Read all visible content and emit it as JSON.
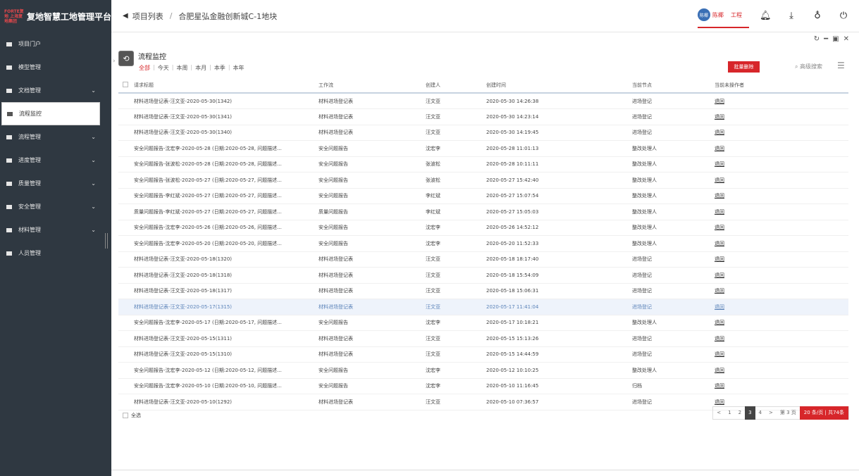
{
  "sidebar": {
    "logo_mark": "FORTE复地 上海复地集团",
    "title": "复地智慧工地管理平台",
    "items": [
      {
        "label": "项目门户",
        "chevron": false
      },
      {
        "label": "模型管理",
        "chevron": false
      },
      {
        "label": "文档管理",
        "chevron": true
      },
      {
        "label": "流程监控",
        "chevron": false,
        "active": true
      },
      {
        "label": "流程管理",
        "chevron": true
      },
      {
        "label": "进度管理",
        "chevron": true
      },
      {
        "label": "质量管理",
        "chevron": true
      },
      {
        "label": "安全管理",
        "chevron": true
      },
      {
        "label": "材料管理",
        "chevron": true
      },
      {
        "label": "人员管理",
        "chevron": false
      }
    ]
  },
  "topbar": {
    "breadcrumb": [
      "项目列表",
      "合肥星弘金融创新城C-1地块"
    ],
    "user_avatar_text": "陈椰",
    "user_name": "陈椰",
    "user_project": "工程",
    "icons": [
      "bell-icon",
      "download-icon",
      "lightbulb-icon",
      "power-icon"
    ]
  },
  "panel": {
    "title": "流程监控",
    "filters": [
      "全部",
      "今天",
      "本周",
      "本月",
      "本季",
      "本年"
    ],
    "active_filter": "全部",
    "batch_delete": "批量删除",
    "advanced_search": "高级搜索"
  },
  "table": {
    "headers": [
      "请求标题",
      "工作流",
      "创建人",
      "创建时间",
      "当前节点",
      "当前未操作者"
    ],
    "rows": [
      [
        "材料进场登记表-汪文亚-2020-05-30(1342)",
        "材料进场登记表",
        "汪文亚",
        "2020-05-30 14:26:38",
        "进场登记",
        "退回"
      ],
      [
        "材料进场登记表-汪文亚-2020-05-30(1341)",
        "材料进场登记表",
        "汪文亚",
        "2020-05-30 14:23:14",
        "进场登记",
        "退回"
      ],
      [
        "材料进场登记表-汪文亚-2020-05-30(1340)",
        "材料进场登记表",
        "汪文亚",
        "2020-05-30 14:19:45",
        "进场登记",
        "退回"
      ],
      [
        "安全问题报告-沈宏李-2020-05-28 (日期:2020-05-28, 问题描述...",
        "安全问题报告",
        "沈宏李",
        "2020-05-28 11:01:13",
        "整改处理人",
        "退回"
      ],
      [
        "安全问题报告-张波松-2020-05-28 (日期:2020-05-28, 问题描述...",
        "安全问题报告",
        "张波松",
        "2020-05-28 10:11:11",
        "整改处理人",
        "退回"
      ],
      [
        "安全问题报告-张波松-2020-05-27 (日期:2020-05-27, 问题描述...",
        "安全问题报告",
        "张波松",
        "2020-05-27 15:42:40",
        "整改处理人",
        "退回"
      ],
      [
        "安全问题报告-李红斌-2020-05-27 (日期:2020-05-27, 问题描述...",
        "安全问题报告",
        "李红斌",
        "2020-05-27 15:07:54",
        "整改处理人",
        "退回"
      ],
      [
        "质量问题报告-李红斌-2020-05-27 (日期:2020-05-27, 问题描述...",
        "质量问题报告",
        "李红斌",
        "2020-05-27 15:05:03",
        "整改处理人",
        "退回"
      ],
      [
        "安全问题报告-沈宏李-2020-05-26 (日期:2020-05-26, 问题描述...",
        "安全问题报告",
        "沈宏李",
        "2020-05-26 14:52:12",
        "整改处理人",
        "退回"
      ],
      [
        "安全问题报告-沈宏李-2020-05-20 (日期:2020-05-20, 问题描述...",
        "安全问题报告",
        "沈宏李",
        "2020-05-20 11:52:33",
        "整改处理人",
        "退回"
      ],
      [
        "材料进场登记表-汪文亚-2020-05-18(1320)",
        "材料进场登记表",
        "汪文亚",
        "2020-05-18 18:17:40",
        "进场登记",
        "退回"
      ],
      [
        "材料进场登记表-汪文亚-2020-05-18(1318)",
        "材料进场登记表",
        "汪文亚",
        "2020-05-18 15:54:09",
        "进场登记",
        "退回"
      ],
      [
        "材料进场登记表-汪文亚-2020-05-18(1317)",
        "材料进场登记表",
        "汪文亚",
        "2020-05-18 15:06:31",
        "进场登记",
        "退回"
      ],
      [
        "材料进场登记表-汪文亚-2020-05-17(1315)",
        "材料进场登记表",
        "汪文亚",
        "2020-05-17 11:41:04",
        "进场登记",
        "退回"
      ],
      [
        "安全问题报告-沈宏李-2020-05-17 (日期:2020-05-17, 问题描述...",
        "安全问题报告",
        "沈宏李",
        "2020-05-17 10:18:21",
        "整改处理人",
        "退回"
      ],
      [
        "材料进场登记表-汪文亚-2020-05-15(1311)",
        "材料进场登记表",
        "汪文亚",
        "2020-05-15 15:13:26",
        "进场登记",
        "退回"
      ],
      [
        "材料进场登记表-汪文亚-2020-05-15(1310)",
        "材料进场登记表",
        "汪文亚",
        "2020-05-15 14:44:59",
        "进场登记",
        "退回"
      ],
      [
        "安全问题报告-沈宏李-2020-05-12 (日期:2020-05-12, 问题描述...",
        "安全问题报告",
        "沈宏李",
        "2020-05-12 10:10:25",
        "整改处理人",
        "退回"
      ],
      [
        "安全问题报告-沈宏李-2020-05-10 (日期:2020-05-10, 问题描述...",
        "安全问题报告",
        "沈宏李",
        "2020-05-10 11:16:45",
        "归档",
        "退回"
      ],
      [
        "材料进场登记表-汪文亚-2020-05-10(1292)",
        "材料进场登记表",
        "汪文亚",
        "2020-05-10 07:36:57",
        "进场登记",
        "退回"
      ]
    ],
    "highlighted_row": 13
  },
  "footer": {
    "select_all": "全选",
    "pager": {
      "prev": "<",
      "pages": [
        "1",
        "2",
        "3",
        "4"
      ],
      "current": "3",
      "next": ">",
      "goto": "第 3 页",
      "size_info": "20 条/页 | 共74条"
    }
  },
  "colors": {
    "accent": "#d7262a",
    "sidebar_bg": "#2f3841"
  }
}
